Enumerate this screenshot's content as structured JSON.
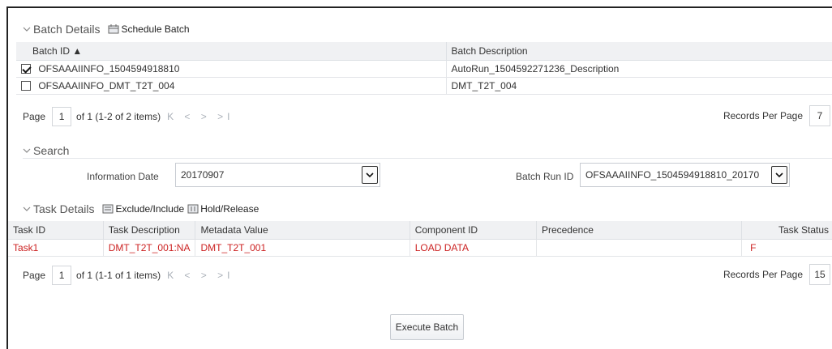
{
  "batch_details": {
    "title": "Batch Details",
    "schedule_label": "Schedule Batch",
    "columns": [
      "Batch ID ▲",
      "Batch Description"
    ],
    "rows": [
      {
        "checked": true,
        "id": "OFSAAAIINFO_1504594918810",
        "desc": "AutoRun_1504592271236_Description"
      },
      {
        "checked": false,
        "id": "OFSAAAIINFO_DMT_T2T_004",
        "desc": "DMT_T2T_004"
      }
    ],
    "pager": {
      "page_label": "Page",
      "page": "1",
      "info": "of 1 (1-2 of 2 items)",
      "nav": "K < > >I",
      "rpp_label": "Records Per Page",
      "rpp": "7"
    }
  },
  "search": {
    "title": "Search",
    "info_date_label": "Information Date",
    "info_date_value": "20170907",
    "batch_run_label": "Batch Run ID",
    "batch_run_value": "OFSAAAIINFO_1504594918810_20170"
  },
  "task_details": {
    "title": "Task Details",
    "exclude_label": "Exclude/Include",
    "hold_label": "Hold/Release",
    "columns": [
      "Task ID",
      "Task Description",
      "Metadata Value",
      "Component ID",
      "Precedence",
      "Task Status"
    ],
    "rows": [
      [
        "Task1",
        "DMT_T2T_001:NA",
        "DMT_T2T_001",
        "LOAD DATA",
        "",
        "F"
      ]
    ],
    "pager": {
      "page_label": "Page",
      "page": "1",
      "info": "of 1 (1-1 of 1 items)",
      "nav": "K < > >I",
      "rpp_label": "Records Per Page",
      "rpp": "15"
    }
  },
  "execute_label": "Execute Batch",
  "colors": {
    "error_red": "#cc2222",
    "header_bg": "#f0f1f3"
  }
}
